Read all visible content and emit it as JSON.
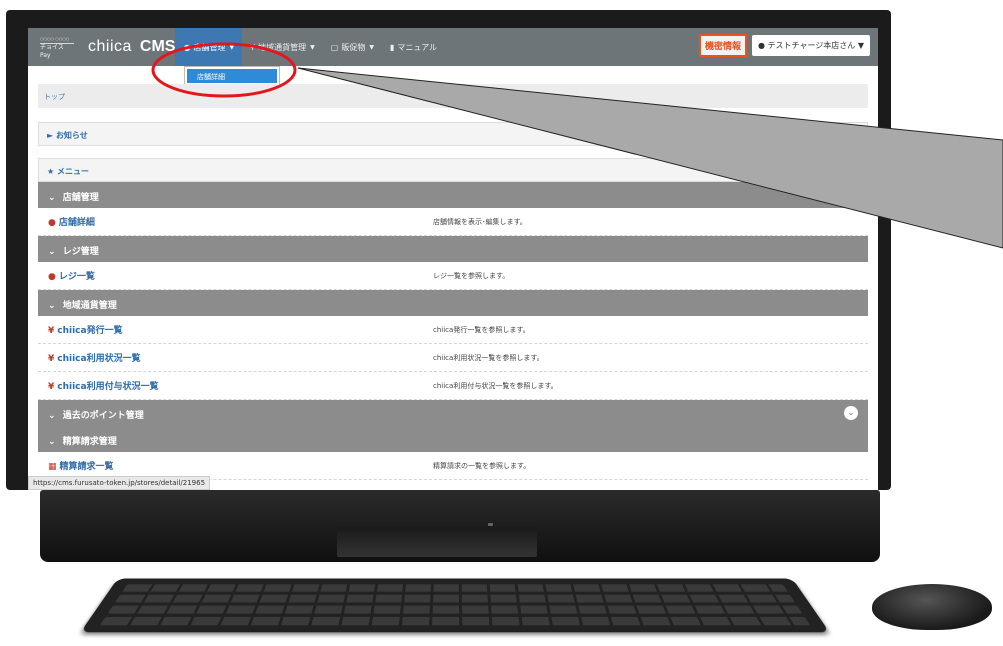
{
  "brand": {
    "small_top": "○○○○ ○○○○",
    "small": "チョイスPay",
    "name": "chiica",
    "cms": "CMS"
  },
  "nav": [
    {
      "label": "店舗管理",
      "icon": "user-icon"
    },
    {
      "label": "地域通貨管理",
      "icon": "yen-icon"
    },
    {
      "label": "販促物",
      "icon": "file-icon"
    },
    {
      "label": "マニュアル",
      "icon": "book-icon"
    }
  ],
  "nav_right": {
    "warning": "機密情報",
    "user": "テストチャージ本店さん"
  },
  "dropdown": {
    "item": "店舗詳細"
  },
  "breadcrumb": "トップ",
  "notice": {
    "title": "お知らせ",
    "tools": "⌄ ✕"
  },
  "menu": {
    "title": "メニュー"
  },
  "sections": [
    {
      "title": "店舗管理",
      "rows": [
        {
          "label": "店舗詳細",
          "desc": "店舗情報を表示･編集します。",
          "icon": "user-icon"
        }
      ]
    },
    {
      "title": "レジ管理",
      "rows": [
        {
          "label": "レジ一覧",
          "desc": "レジ一覧を参照します。",
          "icon": "user-icon"
        }
      ]
    },
    {
      "title": "地域通貨管理",
      "rows": [
        {
          "label": "chiica発行一覧",
          "desc": "chiica発行一覧を参照します。",
          "icon": "yen-icon"
        },
        {
          "label": "chiica利用状況一覧",
          "desc": "chiica利用状況一覧を参照します。",
          "icon": "yen-icon"
        },
        {
          "label": "chiica利用付与状況一覧",
          "desc": "chiica利用付与状況一覧を参照します。",
          "icon": "yen-icon"
        }
      ]
    },
    {
      "title": "過去のポイント管理",
      "rows": []
    },
    {
      "title": "精算請求管理",
      "rows": [
        {
          "label": "精算請求一覧",
          "desc": "精算請求の一覧を参照します。",
          "icon": "calendar-icon"
        }
      ]
    }
  ],
  "status_url": "https://cms.furusato-token.jp/stores/detail/21965",
  "colors": {
    "navbar": "#6d7579",
    "active": "#3d78b3",
    "section": "#8c8c8c",
    "highlight": "#e4161b"
  }
}
